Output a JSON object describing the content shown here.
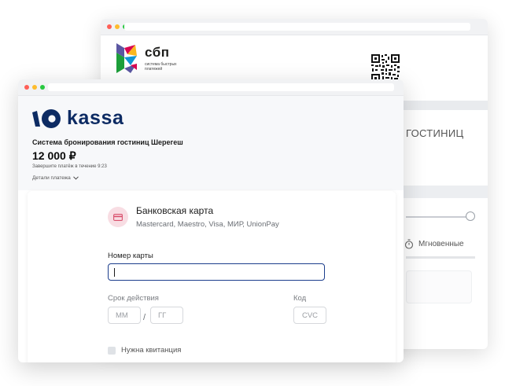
{
  "sbp_window": {
    "logo_name": "сбп",
    "logo_subtitle": "система быстрых платежей",
    "hotel_title_fragment": "ГОСТИНИЦ",
    "speed_label": "Мгновенные",
    "icons": [
      "sbp-logo-icon",
      "qr-code-icon",
      "stopwatch-icon"
    ]
  },
  "kassa_window": {
    "logo_text": "kassa",
    "merchant": "Система бронирования гостиниц Шерегеш",
    "amount": "12 000 ₽",
    "deadline": "Завершите платёж в течение 9:23",
    "details_label": "Детали платежа",
    "payment_method": {
      "title": "Банковская карта",
      "subtitle": "Mastercard, Maestro, Visa, МИР, UnionPay"
    },
    "form": {
      "card_number_label": "Номер карты",
      "card_number_value": "",
      "expiry_label": "Срок действия",
      "month_placeholder": "ММ",
      "year_placeholder": "ГГ",
      "separator": "/",
      "cvc_label": "Код",
      "cvc_placeholder": "CVC",
      "receipt_label": "Нужна квитанция"
    }
  },
  "colors": {
    "kassa_brand": "#0d2b63",
    "focus_border": "#1c3d8c",
    "card_icon_bg": "#f8dde3",
    "sbp_arrow_colors": [
      "#5b57a2",
      "#d90751",
      "#fab71e",
      "#1d9f3a",
      "#1095d3"
    ]
  }
}
